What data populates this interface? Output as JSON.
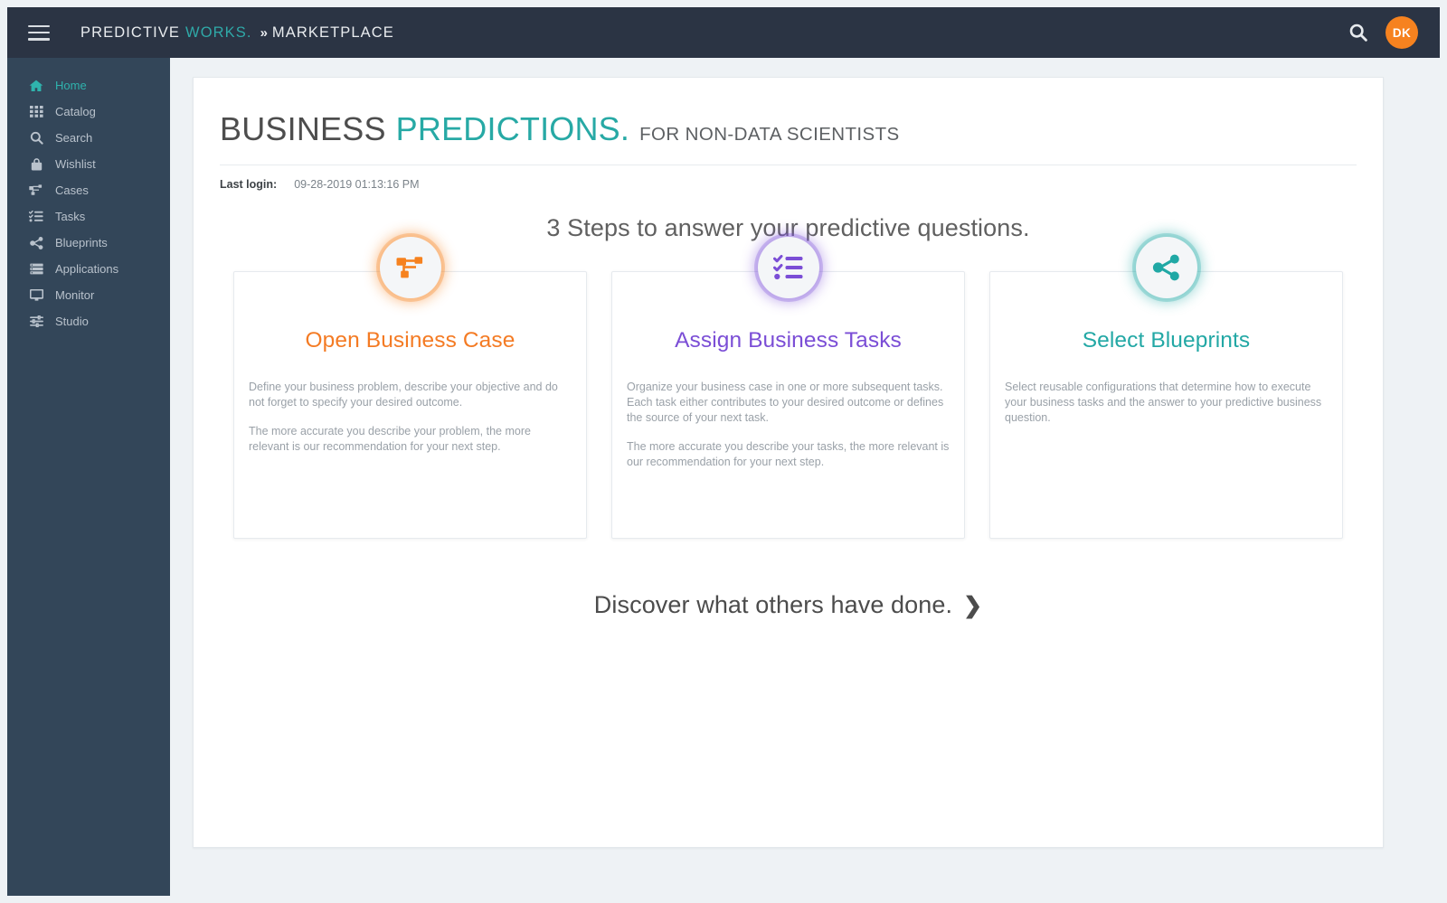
{
  "topbar": {
    "menu_icon": "hamburger-icon",
    "brand_part1": "PREDICTIVE",
    "brand_part2": "WORKS.",
    "brand_separator": "»",
    "brand_section": "MARKETPLACE",
    "search_icon": "search-icon",
    "avatar_initials": "DK",
    "avatar_color": "#f6821f"
  },
  "sidebar": {
    "items": [
      {
        "label": "Home",
        "icon": "home-icon",
        "active": true
      },
      {
        "label": "Catalog",
        "icon": "grid-icon",
        "active": false
      },
      {
        "label": "Search",
        "icon": "search-icon",
        "active": false
      },
      {
        "label": "Wishlist",
        "icon": "bag-icon",
        "active": false
      },
      {
        "label": "Cases",
        "icon": "sitemap-icon",
        "active": false
      },
      {
        "label": "Tasks",
        "icon": "tasklist-icon",
        "active": false
      },
      {
        "label": "Blueprints",
        "icon": "share-nodes-icon",
        "active": false
      },
      {
        "label": "Applications",
        "icon": "server-icon",
        "active": false
      },
      {
        "label": "Monitor",
        "icon": "monitor-icon",
        "active": false
      },
      {
        "label": "Studio",
        "icon": "sliders-icon",
        "active": false
      }
    ],
    "active_color": "#2fb3ad"
  },
  "main": {
    "title_part1": "BUSINESS",
    "title_part2": "PREDICTIONS.",
    "title_part3": "FOR NON-DATA SCIENTISTS",
    "title_accent_color": "#27a9a5",
    "last_login_label": "Last login:",
    "last_login_value": "09-28-2019 01:13:16 PM",
    "steps_heading": "3 Steps to answer your predictive questions.",
    "cards": [
      {
        "icon": "sitemap-icon",
        "title": "Open Business Case",
        "color": "#f47b24",
        "paragraph1": "Define your business problem, describe your objective and do not forget to specify your desired outcome.",
        "paragraph2": "The more accurate you describe your problem, the more relevant is our recommendation for your next step."
      },
      {
        "icon": "tasklist-icon",
        "title": "Assign Business Tasks",
        "color": "#7b4ed6",
        "paragraph1": "Organize your business case in one or more subsequent tasks. Each task either contributes to your desired outcome or defines the source of your next task.",
        "paragraph2": "The more accurate you describe your tasks, the more relevant is our recommendation for your next step."
      },
      {
        "icon": "share-nodes-icon",
        "title": "Select Blueprints",
        "color": "#23a8a5",
        "paragraph1": "Select reusable configurations that determine how to execute your business tasks and the answer to your predictive business question.",
        "paragraph2": ""
      }
    ],
    "discover_label": "Discover what others have done.",
    "discover_chevron": "❯"
  }
}
